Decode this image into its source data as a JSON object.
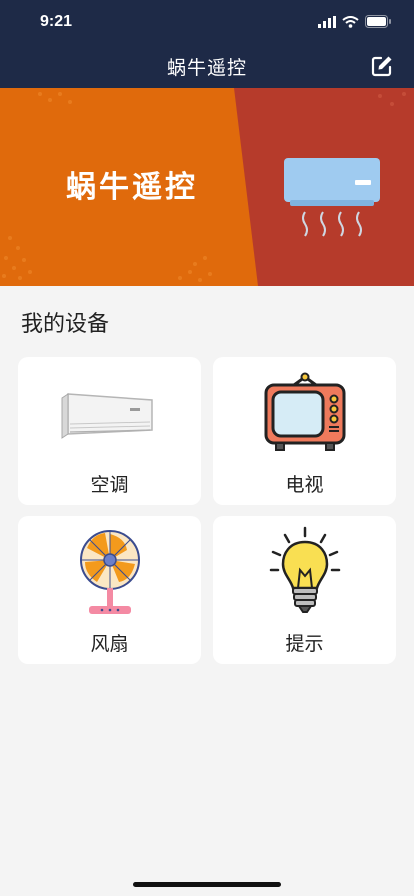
{
  "status_bar": {
    "time": "9:21"
  },
  "nav": {
    "title": "蜗牛遥控"
  },
  "banner": {
    "text": "蜗牛遥控",
    "colors": {
      "left": "#e06a0c",
      "right": "#b63b2b"
    }
  },
  "section": {
    "title": "我的设备"
  },
  "devices": [
    {
      "label": "空调",
      "icon": "air-conditioner-icon"
    },
    {
      "label": "电视",
      "icon": "tv-icon"
    },
    {
      "label": "风扇",
      "icon": "fan-icon"
    },
    {
      "label": "提示",
      "icon": "lightbulb-icon"
    }
  ],
  "theme": {
    "nav_bg": "#1e2a47",
    "page_bg": "#f4f4f4",
    "card_bg": "#ffffff"
  }
}
